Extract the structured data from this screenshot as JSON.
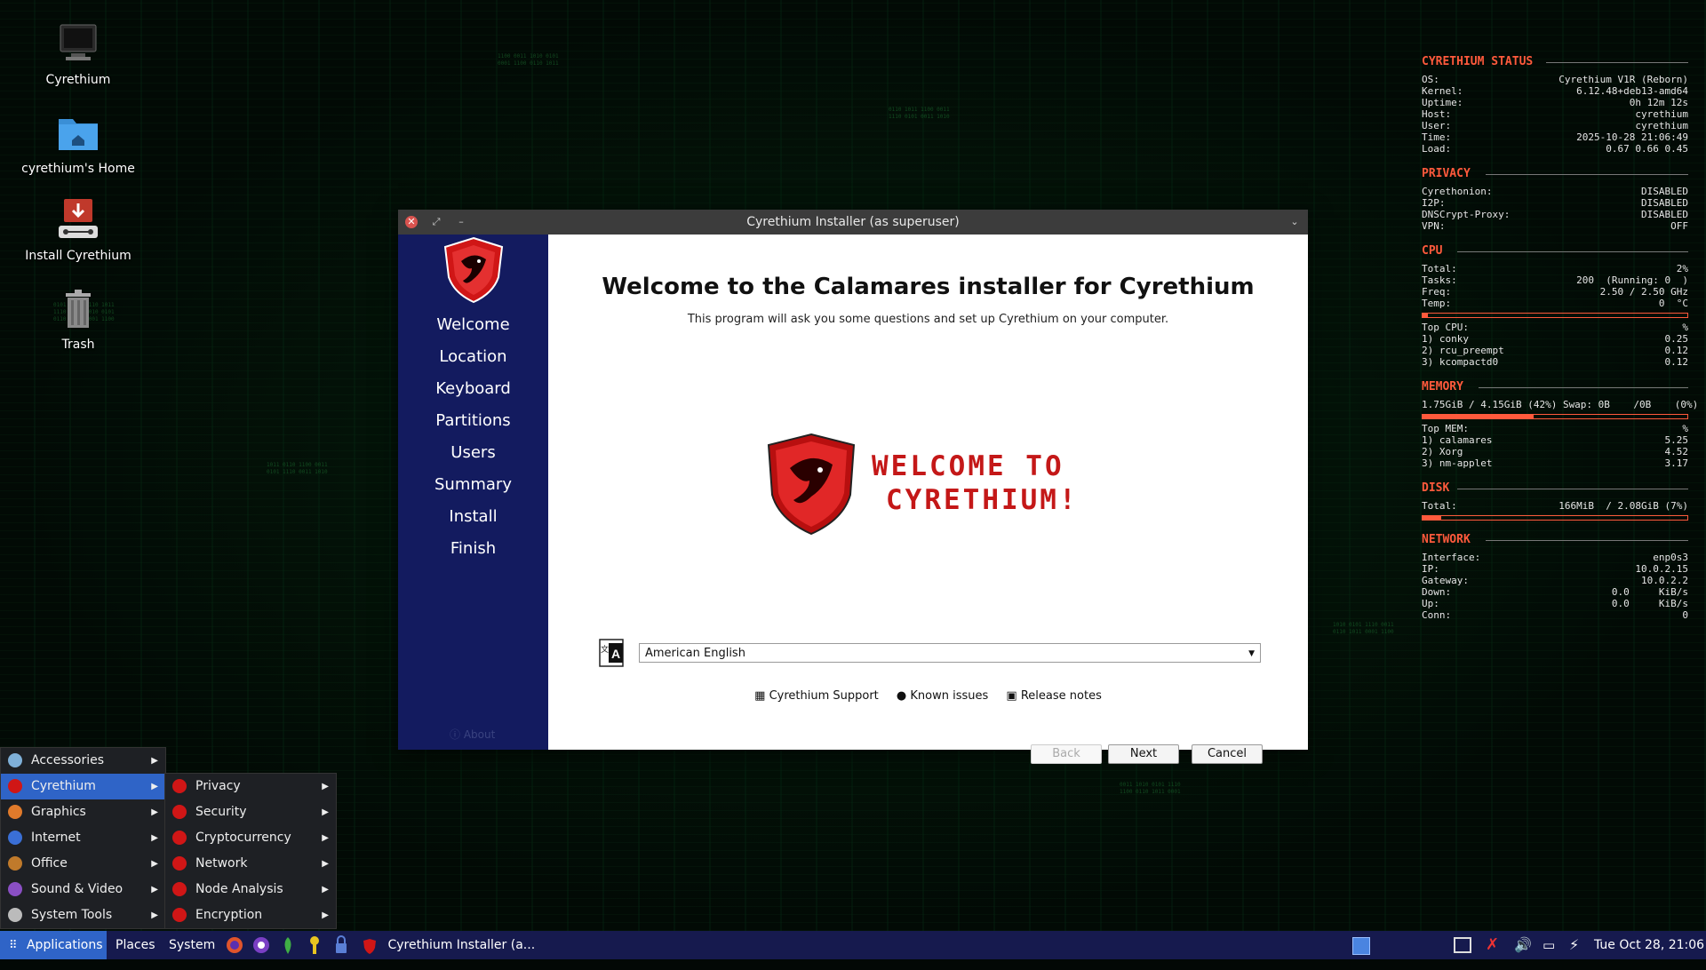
{
  "desktop": {
    "icons": [
      {
        "label": "Cyrethium"
      },
      {
        "label": "cyrethium's Home"
      },
      {
        "label": "Install Cyrethium"
      },
      {
        "label": "Trash"
      }
    ]
  },
  "installer": {
    "window_title": "Cyrethium Installer (as superuser)",
    "sidebar_steps": [
      "Welcome",
      "Location",
      "Keyboard",
      "Partitions",
      "Users",
      "Summary",
      "Install",
      "Finish"
    ],
    "about_label": "About",
    "welcome_title": "Welcome to the Calamares installer for Cyrethium",
    "welcome_subtitle": "This program will ask you some questions and set up Cyrethium on your computer.",
    "banner_text_line1": "WELCOME TO",
    "banner_text_line2": "CYRETHIUM!",
    "language_value": "American English",
    "links": [
      "Cyrethium Support",
      "Known issues",
      "Release notes"
    ],
    "buttons": {
      "back": "Back",
      "next": "Next",
      "cancel": "Cancel"
    }
  },
  "conky": {
    "status_title": "CYRETHIUM STATUS",
    "status": [
      {
        "k": "OS:",
        "v": "Cyrethium V1R (Reborn)"
      },
      {
        "k": "Kernel:",
        "v": "6.12.48+deb13-amd64"
      },
      {
        "k": "Uptime:",
        "v": "0h 12m 12s"
      },
      {
        "k": "Host:",
        "v": "cyrethium"
      },
      {
        "k": "User:",
        "v": "cyrethium"
      },
      {
        "k": "Time:",
        "v": "2025-10-28 21:06:49"
      },
      {
        "k": "Load:",
        "v": "0.67 0.66 0.45"
      }
    ],
    "privacy_title": "PRIVACY",
    "privacy": [
      {
        "k": "Cyrethonion:",
        "v": "DISABLED"
      },
      {
        "k": "I2P:",
        "v": "DISABLED"
      },
      {
        "k": "DNSCrypt-Proxy:",
        "v": "DISABLED"
      },
      {
        "k": "VPN:",
        "v": "OFF"
      }
    ],
    "cpu_title": "CPU",
    "cpu": [
      {
        "k": "Total:",
        "v": "2%"
      },
      {
        "k": "Tasks:",
        "v": "200  (Running: 0  )"
      },
      {
        "k": "Freq:",
        "v": "2.50 / 2.50 GHz"
      },
      {
        "k": "Temp:",
        "v": "0  °C"
      }
    ],
    "cpu_bar_fraction": 0.02,
    "top_cpu_label": "Top CPU:",
    "top_cpu_unit": "%",
    "top_cpu": [
      {
        "k": "1) conky",
        "v": "0.25"
      },
      {
        "k": "2) rcu_preempt",
        "v": "0.12"
      },
      {
        "k": "3) kcompactd0",
        "v": "0.12"
      }
    ],
    "memory_title": "MEMORY",
    "memory_line": "1.75GiB / 4.15GiB (42%) Swap: 0B    /0B    (0%)",
    "memory_bar_fraction": 0.42,
    "top_mem_label": "Top MEM:",
    "top_mem_unit": "%",
    "top_mem": [
      {
        "k": "1) calamares",
        "v": "5.25"
      },
      {
        "k": "2) Xorg",
        "v": "4.52"
      },
      {
        "k": "3) nm-applet",
        "v": "3.17"
      }
    ],
    "disk_title": "DISK",
    "disk": [
      {
        "k": "Total:",
        "v": "166MiB  / 2.08GiB (7%)"
      }
    ],
    "disk_bar_fraction": 0.07,
    "network_title": "NETWORK",
    "network": [
      {
        "k": "Interface:",
        "v": "enp0s3"
      },
      {
        "k": "IP:",
        "v": "10.0.2.15"
      },
      {
        "k": "Gateway:",
        "v": "10.0.2.2"
      },
      {
        "k": "Down:",
        "v": "0.0     KiB/s"
      },
      {
        "k": "Up:",
        "v": "0.0     KiB/s"
      },
      {
        "k": "Conn:",
        "v": "0"
      }
    ]
  },
  "app_menu": {
    "categories": [
      "Accessories",
      "Cyrethium",
      "Graphics",
      "Internet",
      "Office",
      "Sound & Video",
      "System Tools"
    ],
    "active_category": "Cyrethium",
    "submenu": [
      "Privacy",
      "Security",
      "Cryptocurrency",
      "Network",
      "Node Analysis",
      "Encryption"
    ]
  },
  "taskbar": {
    "applications": "Applications",
    "places": "Places",
    "system": "System",
    "task_label": "Cyrethium Installer (a...",
    "clock": "Tue Oct 28, 21:06"
  },
  "colors": {
    "accent": "#ff5a3c",
    "sidebar": "#131b5f",
    "taskbar": "#161a4e",
    "menu_highlight": "#2f64c7"
  }
}
